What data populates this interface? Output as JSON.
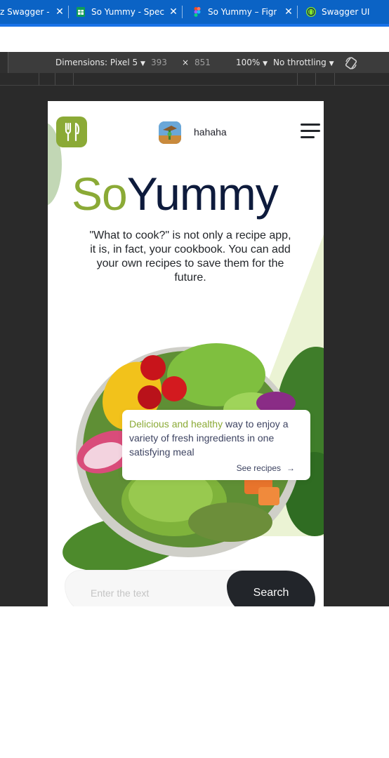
{
  "browser": {
    "tabs": [
      {
        "label": "z Swagger -",
        "icon": "swagger-icon"
      },
      {
        "label": "So Yummy - Spec",
        "icon": "sheets-icon"
      },
      {
        "label": "So Yummy – Figm",
        "icon": "figma-icon"
      },
      {
        "label": "Swagger UI",
        "icon": "swagger-icon"
      }
    ]
  },
  "devtools": {
    "dimensions_label": "Dimensions: Pixel 5",
    "width": "393",
    "times": "×",
    "height": "851",
    "zoom": "100%",
    "throttling": "No throttling"
  },
  "app": {
    "username": "hahaha",
    "title_so": "So",
    "title_yummy": "Yummy",
    "description": "\"What to cook?\" is not only a recipe app, it is, in fact, your cookbook. You can add your own recipes to save them for the future.",
    "card": {
      "highlight": "Delicious and healthy",
      "text": " way to enjoy a variety of fresh ingredients in one satisfying meal",
      "link": "See recipes",
      "link_arrow": "→"
    },
    "search": {
      "placeholder": "Enter the text",
      "button": "Search"
    },
    "colors": {
      "accent": "#8baa36",
      "dark": "#22252a",
      "title": "#0e1b3c"
    }
  }
}
